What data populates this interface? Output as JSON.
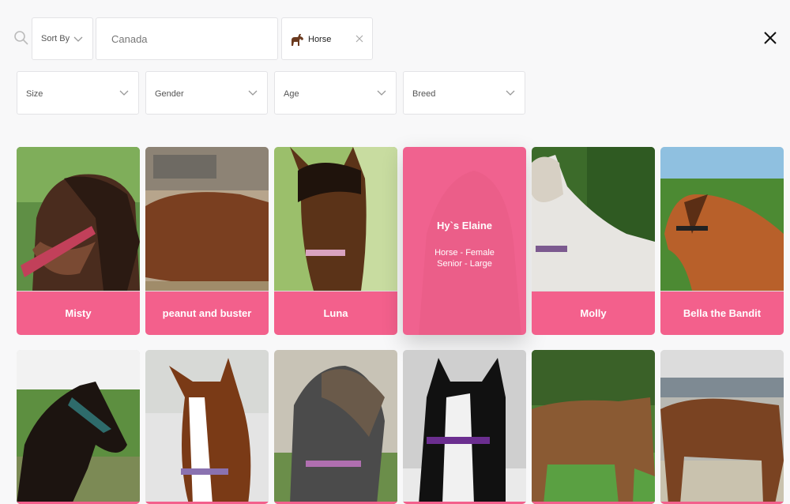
{
  "search": {
    "sort_label": "Sort By",
    "location_value": "Canada",
    "tag_label": "Horse"
  },
  "filters": [
    {
      "label": "Size"
    },
    {
      "label": "Gender"
    },
    {
      "label": "Age"
    },
    {
      "label": "Breed"
    }
  ],
  "row1": [
    {
      "name": "Misty"
    },
    {
      "name": "peanut and buster"
    },
    {
      "name": "Luna"
    },
    {
      "name": "Hy`s Elaine",
      "detail1": "Horse - Female",
      "detail2": "Senior - Large"
    },
    {
      "name": "Molly"
    },
    {
      "name": "Bella the Bandit"
    }
  ],
  "colors": {
    "accent": "#f3608c",
    "hover_overlay": "#f0628f",
    "background": "#f8f8f9"
  },
  "icons": {
    "search": "search-icon",
    "dropdown": "chevron-down-icon",
    "tag": "horse-icon",
    "remove": "close-icon",
    "close": "close-icon"
  }
}
